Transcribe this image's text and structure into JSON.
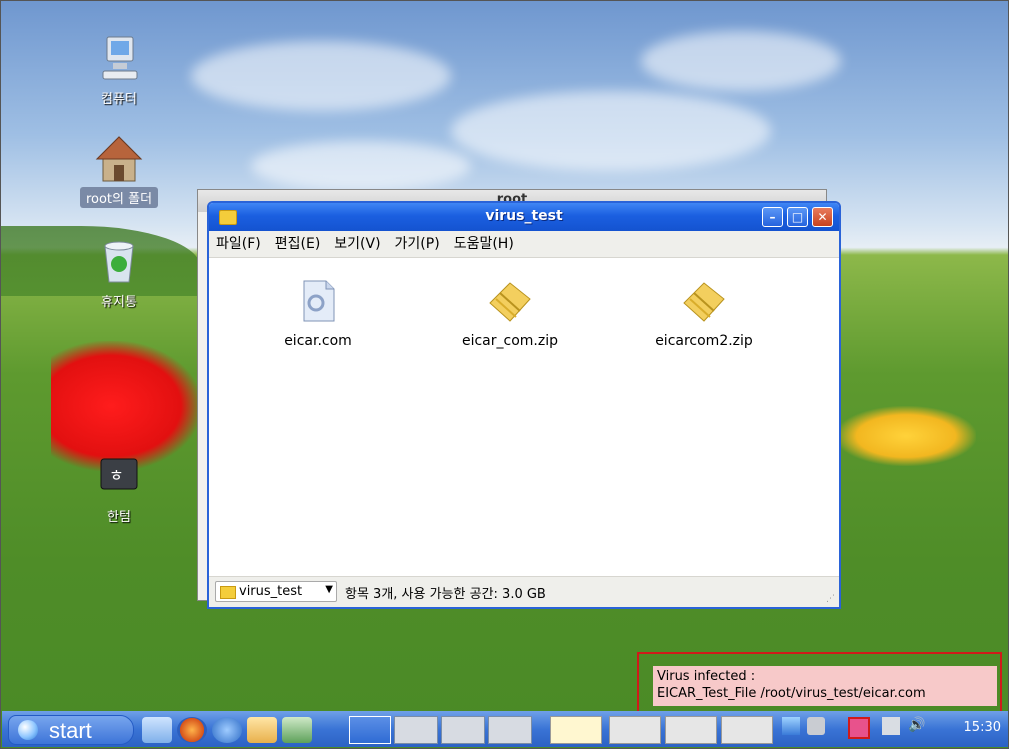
{
  "desktop": {
    "icons": [
      {
        "label": "컴퓨터",
        "selected": false
      },
      {
        "label": "root의 폴더",
        "selected": true
      },
      {
        "label": "휴지통",
        "selected": false
      },
      {
        "label": "한텀",
        "selected": false
      }
    ]
  },
  "background_window": {
    "title": "root"
  },
  "window": {
    "title": "virus_test",
    "menu": [
      "파일(F)",
      "편집(E)",
      "보기(V)",
      "가기(P)",
      "도움말(H)"
    ],
    "files": [
      {
        "name": "eicar.com",
        "icon": "document-icon"
      },
      {
        "name": "eicar_com.zip",
        "icon": "zip-archive-icon"
      },
      {
        "name": "eicarcom2.zip",
        "icon": "zip-archive-icon"
      }
    ],
    "location": "virus_test",
    "status": "항목 3개, 사용 가능한 공간: 3.0 GB"
  },
  "notification": {
    "line1": "Virus infected :",
    "line2": "EICAR_Test_File /root/virus_test/eicar.com"
  },
  "taskbar": {
    "start_label": "start",
    "clock": "15:30"
  },
  "colors": {
    "titlebar": "#1b5fe0",
    "notification_bg": "#f7c9c9",
    "notification_border": "#d01a1a"
  }
}
